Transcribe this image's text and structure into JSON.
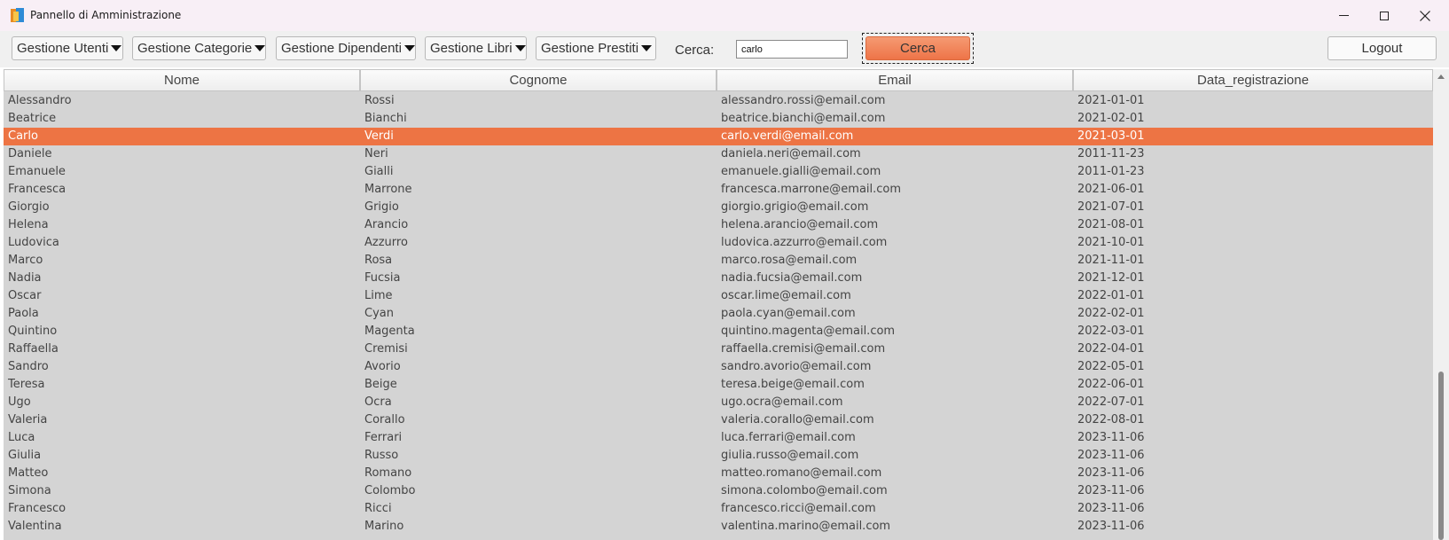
{
  "window": {
    "title": "Pannello di Amministrazione",
    "app_icon": "books-icon",
    "controls": [
      "minimize-icon",
      "maximize-icon",
      "close-icon"
    ]
  },
  "toolbar": {
    "menus": [
      {
        "label": "Gestione Utenti"
      },
      {
        "label": "Gestione Categorie"
      },
      {
        "label": "Gestione Dipendenti"
      },
      {
        "label": "Gestione Libri"
      },
      {
        "label": "Gestione Prestiti"
      }
    ],
    "search_label": "Cerca:",
    "search_value": "carlo",
    "search_button": "Cerca",
    "logout_button": "Logout"
  },
  "colors": {
    "selected_row": "#ed7444",
    "search_button": "#f08050",
    "table_background": "#d4d4d4"
  },
  "table": {
    "columns": [
      "Nome",
      "Cognome",
      "Email",
      "Data_registrazione"
    ],
    "selected_index": 2,
    "rows": [
      [
        "Alessandro",
        "Rossi",
        "alessandro.rossi@email.com",
        "2021-01-01"
      ],
      [
        "Beatrice",
        "Bianchi",
        "beatrice.bianchi@email.com",
        "2021-02-01"
      ],
      [
        "Carlo",
        "Verdi",
        "carlo.verdi@email.com",
        "2021-03-01"
      ],
      [
        "Daniele",
        "Neri",
        "daniela.neri@email.com",
        "2011-11-23"
      ],
      [
        "Emanuele",
        "Gialli",
        "emanuele.gialli@email.com",
        "2011-01-23"
      ],
      [
        "Francesca",
        "Marrone",
        "francesca.marrone@email.com",
        "2021-06-01"
      ],
      [
        "Giorgio",
        "Grigio",
        "giorgio.grigio@email.com",
        "2021-07-01"
      ],
      [
        "Helena",
        "Arancio",
        "helena.arancio@email.com",
        "2021-08-01"
      ],
      [
        "Ludovica",
        "Azzurro",
        "ludovica.azzurro@email.com",
        "2021-10-01"
      ],
      [
        "Marco",
        "Rosa",
        "marco.rosa@email.com",
        "2021-11-01"
      ],
      [
        "Nadia",
        "Fucsia",
        "nadia.fucsia@email.com",
        "2021-12-01"
      ],
      [
        "Oscar",
        "Lime",
        "oscar.lime@email.com",
        "2022-01-01"
      ],
      [
        "Paola",
        "Cyan",
        "paola.cyan@email.com",
        "2022-02-01"
      ],
      [
        "Quintino",
        "Magenta",
        "quintino.magenta@email.com",
        "2022-03-01"
      ],
      [
        "Raffaella",
        "Cremisi",
        "raffaella.cremisi@email.com",
        "2022-04-01"
      ],
      [
        "Sandro",
        "Avorio",
        "sandro.avorio@email.com",
        "2022-05-01"
      ],
      [
        "Teresa",
        "Beige",
        "teresa.beige@email.com",
        "2022-06-01"
      ],
      [
        "Ugo",
        "Ocra",
        "ugo.ocra@email.com",
        "2022-07-01"
      ],
      [
        "Valeria",
        "Corallo",
        "valeria.corallo@email.com",
        "2022-08-01"
      ],
      [
        "Luca",
        "Ferrari",
        "luca.ferrari@email.com",
        "2023-11-06"
      ],
      [
        "Giulia",
        "Russo",
        "giulia.russo@email.com",
        "2023-11-06"
      ],
      [
        "Matteo",
        "Romano",
        "matteo.romano@email.com",
        "2023-11-06"
      ],
      [
        "Simona",
        "Colombo",
        "simona.colombo@email.com",
        "2023-11-06"
      ],
      [
        "Francesco",
        "Ricci",
        "francesco.ricci@email.com",
        "2023-11-06"
      ],
      [
        "Valentina",
        "Marino",
        "valentina.marino@email.com",
        "2023-11-06"
      ]
    ]
  }
}
